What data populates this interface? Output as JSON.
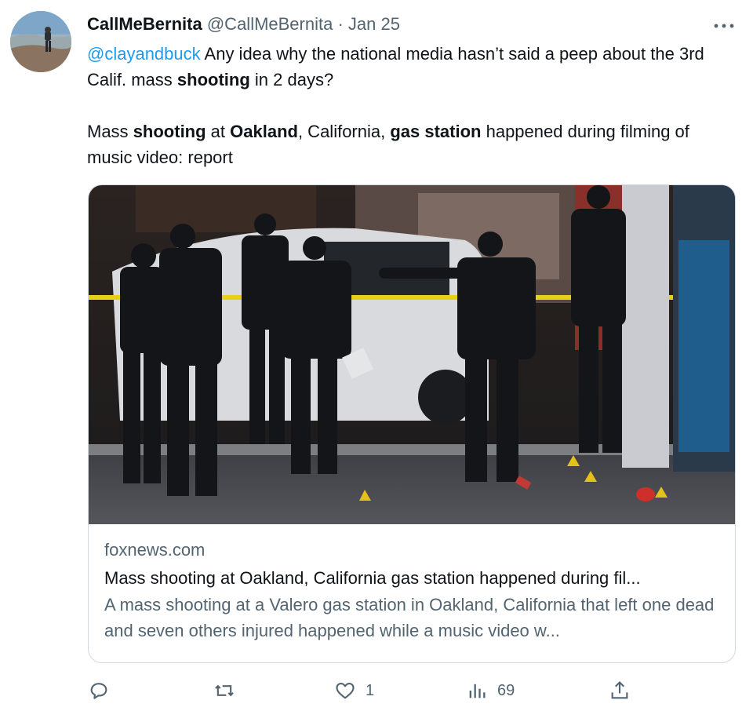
{
  "tweet": {
    "display_name": "CallMeBernita",
    "handle": "@CallMeBernita",
    "separator": "·",
    "date": "Jan 25",
    "more_icon": "more-horizontal-icon",
    "text": {
      "mention": "@clayandbuck",
      "line1_rest": " Any idea why the national media hasn’t said a peep about the 3rd Calif. mass ",
      "line1_bold": "shooting",
      "line1_end": " in 2 days?",
      "p2_a": "Mass ",
      "p2_b_bold": "shooting",
      "p2_c": " at ",
      "p2_d_bold": "Oakland",
      "p2_e": ", California, ",
      "p2_f_bold": "gas station",
      "p2_g": " happened during filming of music video: report"
    }
  },
  "card": {
    "domain": "foxnews.com",
    "title": "Mass shooting at Oakland, California gas station happened during fil...",
    "description": "A mass shooting at a Valero gas station in Oakland, California that left one dead and seven others injured happened while a music video w..."
  },
  "actions": {
    "reply_icon": "reply-icon",
    "retweet_icon": "retweet-icon",
    "like_icon": "heart-icon",
    "like_count": "1",
    "views_icon": "views-icon",
    "views_count": "69",
    "share_icon": "share-icon"
  },
  "colors": {
    "link": "#1d9bf0",
    "secondary": "#536471",
    "primary": "#0f1419",
    "border": "#cfd9de"
  }
}
